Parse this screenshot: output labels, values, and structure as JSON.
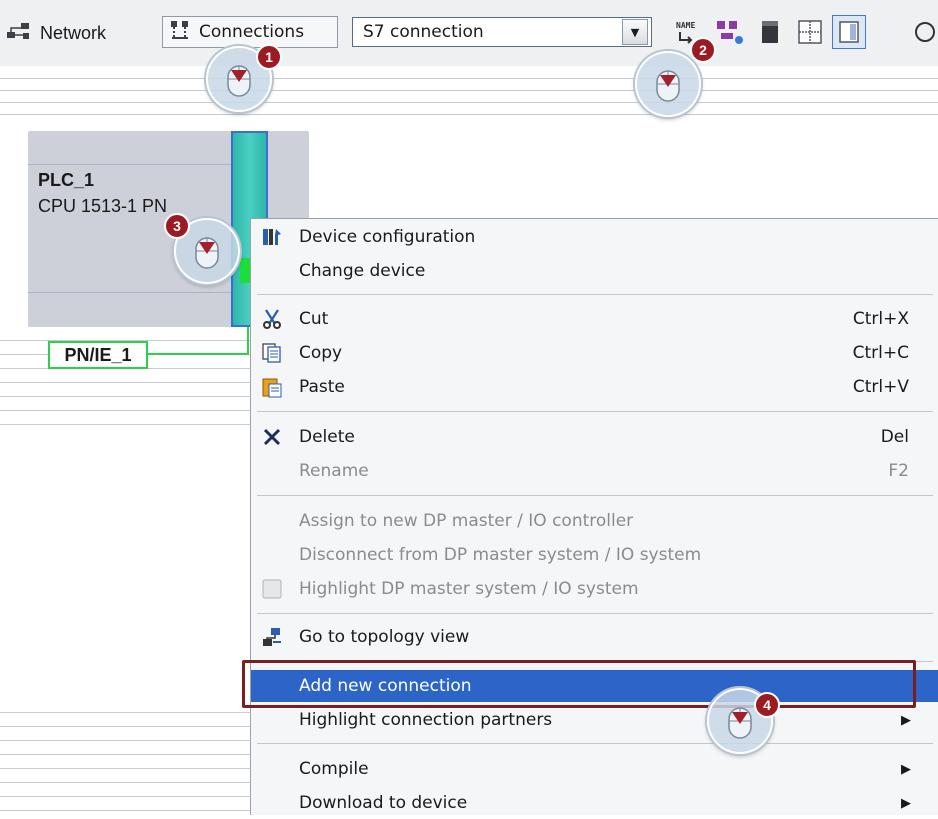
{
  "toolbar": {
    "network_label": "Network",
    "connections_label": "Connections",
    "connection_type_value": "S7 connection"
  },
  "plc": {
    "name": "PLC_1",
    "type": "CPU 1513-1 PN"
  },
  "subnet": {
    "label": "PN/IE_1"
  },
  "context_menu": {
    "items": [
      {
        "label": "Device configuration"
      },
      {
        "label": "Change device"
      },
      {
        "label": "Cut",
        "shortcut": "Ctrl+X"
      },
      {
        "label": "Copy",
        "shortcut": "Ctrl+C"
      },
      {
        "label": "Paste",
        "shortcut": "Ctrl+V"
      },
      {
        "label": "Delete",
        "shortcut": "Del"
      },
      {
        "label": "Rename",
        "shortcut": "F2"
      },
      {
        "label": "Assign to new DP master / IO controller"
      },
      {
        "label": "Disconnect from DP master system / IO system"
      },
      {
        "label": "Highlight DP master system / IO system"
      },
      {
        "label": "Go to topology view"
      },
      {
        "label": "Add new connection"
      },
      {
        "label": "Highlight connection partners"
      },
      {
        "label": "Compile"
      },
      {
        "label": "Download to device"
      }
    ]
  },
  "steps": [
    "1",
    "2",
    "3",
    "4"
  ],
  "colors": {
    "highlight": "#2c65c7",
    "step_badge": "#9b1b22",
    "frame": "#7a1e1e",
    "subnet": "#2bd14a"
  }
}
